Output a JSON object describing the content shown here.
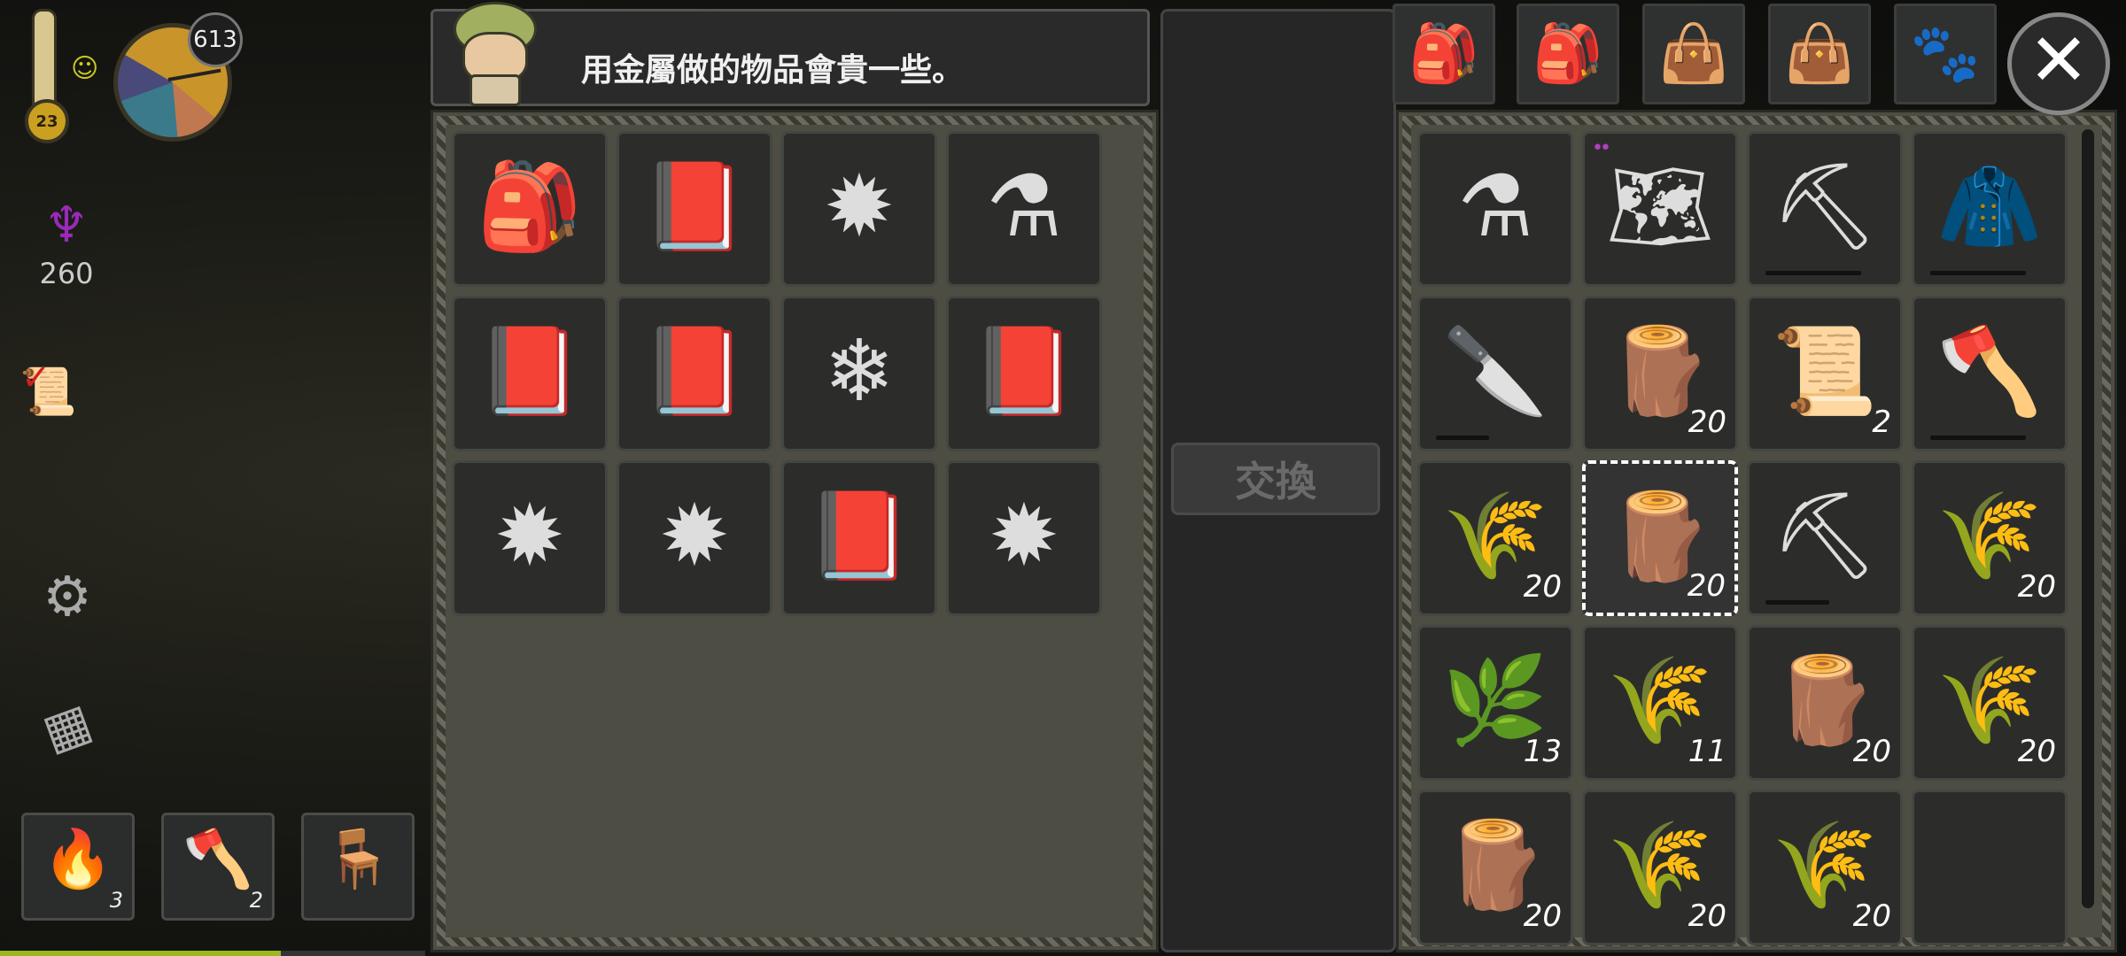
{
  "hud": {
    "temperature": "23",
    "day": "613",
    "sanity": "260",
    "xp_fraction": 0.66,
    "quick_slots": [
      {
        "icon": "torch-icon",
        "glyph": "🔥",
        "count": "3"
      },
      {
        "icon": "axe-icon",
        "glyph": "🪓",
        "count": "2"
      },
      {
        "icon": "workbench-icon",
        "glyph": "🪑",
        "count": ""
      }
    ]
  },
  "dialog": {
    "text": "用金屬做的物品會貴一些。"
  },
  "exchange": {
    "label": "交換"
  },
  "trader_items": [
    {
      "icon": "backpack-icon",
      "glyph": "🎒",
      "count": ""
    },
    {
      "icon": "book-icon",
      "glyph": "📕",
      "count": ""
    },
    {
      "icon": "gold-star-icon",
      "glyph": "✹",
      "count": ""
    },
    {
      "icon": "potion-icon",
      "glyph": "⚗",
      "count": ""
    },
    {
      "icon": "book-icon",
      "glyph": "📕",
      "count": ""
    },
    {
      "icon": "book-icon",
      "glyph": "📕",
      "count": ""
    },
    {
      "icon": "salt-pile-icon",
      "glyph": "❄",
      "count": ""
    },
    {
      "icon": "book-icon",
      "glyph": "📕",
      "count": ""
    },
    {
      "icon": "gold-star-icon",
      "glyph": "✹",
      "count": ""
    },
    {
      "icon": "gold-star-icon",
      "glyph": "✹",
      "count": ""
    },
    {
      "icon": "book-icon",
      "glyph": "📕",
      "count": ""
    },
    {
      "icon": "gold-star-icon",
      "glyph": "✹",
      "count": ""
    }
  ],
  "inventory_items": [
    {
      "icon": "potion-icon",
      "glyph": "⚗",
      "count": ""
    },
    {
      "icon": "map-icon",
      "glyph": "🗺",
      "count": "",
      "dots": "••"
    },
    {
      "icon": "shovel-icon",
      "glyph": "⛏",
      "count": "",
      "durability": 0.9
    },
    {
      "icon": "fur-cloak-icon",
      "glyph": "🧥",
      "count": "",
      "durability": 0.9
    },
    {
      "icon": "knife-icon",
      "glyph": "🔪",
      "count": "",
      "durability": 0.5
    },
    {
      "icon": "logs-icon",
      "glyph": "🪵",
      "count": "20"
    },
    {
      "icon": "scroll-icon",
      "glyph": "📜",
      "count": "2"
    },
    {
      "icon": "axe-icon",
      "glyph": "🪓",
      "count": "",
      "durability": 0.9
    },
    {
      "icon": "grass-bundle-icon",
      "glyph": "🌾",
      "count": "20"
    },
    {
      "icon": "logs-icon",
      "glyph": "🪵",
      "count": "20",
      "selected": true
    },
    {
      "icon": "pickaxe-icon",
      "glyph": "⛏",
      "count": "",
      "durability": 0.6
    },
    {
      "icon": "grass-bundle-icon",
      "glyph": "🌾",
      "count": "20"
    },
    {
      "icon": "twig-icon",
      "glyph": "🌿",
      "count": "13"
    },
    {
      "icon": "grass-bundle-icon",
      "glyph": "🌾",
      "count": "11"
    },
    {
      "icon": "logs-icon",
      "glyph": "🪵",
      "count": "20"
    },
    {
      "icon": "grass-bundle-icon",
      "glyph": "🌾",
      "count": "20"
    },
    {
      "icon": "logs-icon",
      "glyph": "🪵",
      "count": "20"
    },
    {
      "icon": "grass-bundle-icon",
      "glyph": "🌾",
      "count": "20"
    },
    {
      "icon": "grass-bundle-icon",
      "glyph": "🌾",
      "count": "20"
    },
    {
      "icon": "empty",
      "glyph": "",
      "count": ""
    }
  ],
  "tabs": [
    {
      "icon": "backpack-red-icon",
      "glyph": "🎒"
    },
    {
      "icon": "backpack-icon",
      "glyph": "🎒"
    },
    {
      "icon": "satchel-icon",
      "glyph": "👜"
    },
    {
      "icon": "satchel-icon",
      "glyph": "👜"
    },
    {
      "icon": "pet-icon",
      "glyph": "🐾"
    }
  ],
  "close": {
    "label": "✕"
  }
}
